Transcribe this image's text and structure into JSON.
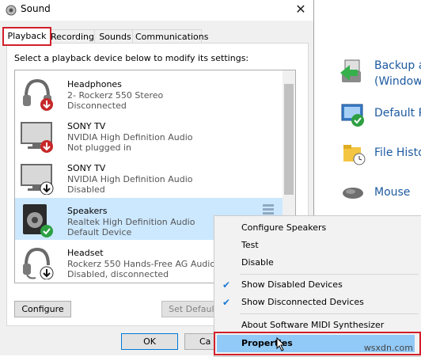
{
  "dialog": {
    "title": "Sound",
    "tabs": [
      "Playback",
      "Recording",
      "Sounds",
      "Communications"
    ],
    "instruction": "Select a playback device below to modify its settings:",
    "devices": [
      {
        "name": "Headphones",
        "desc": "2- Rockerz 550 Stereo",
        "status": "Disconnected",
        "icon": "headphones-icon",
        "badge": "red-down-arrow"
      },
      {
        "name": "SONY TV",
        "desc": "NVIDIA High Definition Audio",
        "status": "Not plugged in",
        "icon": "monitor-icon",
        "badge": "red-down-arrow"
      },
      {
        "name": "SONY TV",
        "desc": "NVIDIA High Definition Audio",
        "status": "Disabled",
        "icon": "monitor-icon",
        "badge": "black-down-arrow"
      },
      {
        "name": "Speakers",
        "desc": "Realtek High Definition Audio",
        "status": "Default Device",
        "icon": "speaker-icon",
        "badge": "green-check"
      },
      {
        "name": "Headset",
        "desc": "Rockerz 550 Hands-Free AG Audio",
        "status": "Disabled, disconnected",
        "icon": "headset-icon",
        "badge": "black-down-arrow"
      }
    ],
    "buttons": {
      "configure": "Configure",
      "set_default": "Set Default",
      "ok": "OK",
      "cancel": "Ca"
    }
  },
  "context_menu": {
    "items": [
      {
        "label": "Configure Speakers",
        "checked": false
      },
      {
        "label": "Test",
        "checked": false
      },
      {
        "label": "Disable",
        "checked": false
      },
      {
        "label": "Show Disabled Devices",
        "checked": true
      },
      {
        "label": "Show Disconnected Devices",
        "checked": true
      },
      {
        "label": "About Software MIDI Synthesizer",
        "checked": false
      },
      {
        "label": "Properties",
        "checked": false
      }
    ]
  },
  "control_panel": {
    "items": [
      {
        "label": "Backup a",
        "label2": "(Window",
        "icon": "backup-icon"
      },
      {
        "label": "Default P",
        "icon": "default-programs-icon"
      },
      {
        "label": "File Histo",
        "icon": "file-history-icon"
      },
      {
        "label": "Mouse",
        "icon": "mouse-icon"
      }
    ]
  },
  "watermark": "wsxdn.com",
  "colors": {
    "highlight_box": "#d0202a",
    "selected_row": "#cce8ff",
    "menu_hover": "#91c9f7",
    "link": "#1e5aa0"
  }
}
